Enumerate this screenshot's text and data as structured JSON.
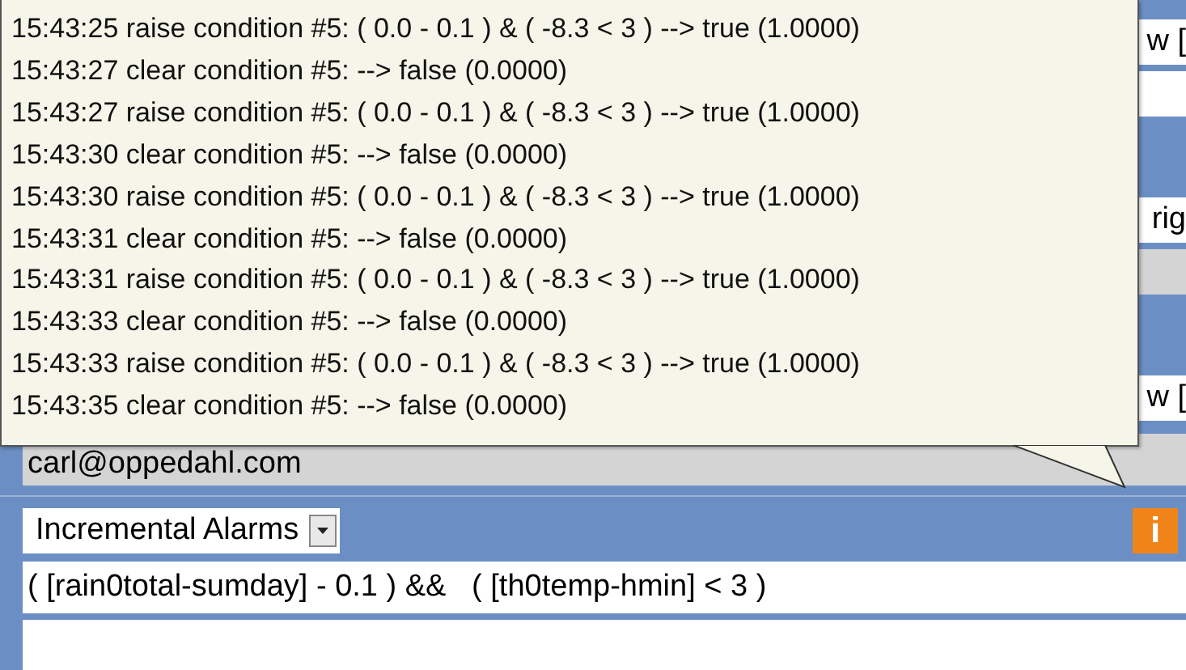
{
  "background_fields": [
    {
      "kind": "text",
      "value": "w ["
    },
    {
      "kind": "text"
    },
    {
      "kind": "band"
    },
    {
      "kind": "text",
      "value": "rig"
    },
    {
      "kind": "grey"
    },
    {
      "kind": "band"
    },
    {
      "kind": "text",
      "value": "w ["
    }
  ],
  "email": "carl@oppedahl.com",
  "alarm_type": {
    "value": "Incremental Alarms",
    "info": "i"
  },
  "condition": "( [rain0total-sumday] - 0.1 ) &&   ( [th0temp-hmin] < 3 )",
  "tooltip": {
    "lines": [
      "15:43:25 raise condition #5: ( 0.0 - 0.1 ) & ( -8.3 < 3 ) --> true (1.0000)",
      "15:43:27 clear condition #5: --> false (0.0000)",
      "15:43:27 raise condition #5: ( 0.0 - 0.1 ) & ( -8.3 < 3 ) --> true (1.0000)",
      "15:43:30 clear condition #5: --> false (0.0000)",
      "15:43:30 raise condition #5: ( 0.0 - 0.1 ) & ( -8.3 < 3 ) --> true (1.0000)",
      "15:43:31 clear condition #5: --> false (0.0000)",
      "15:43:31 raise condition #5: ( 0.0 - 0.1 ) & ( -8.3 < 3 ) --> true (1.0000)",
      "15:43:33 clear condition #5: --> false (0.0000)",
      "15:43:33 raise condition #5: ( 0.0 - 0.1 ) & ( -8.3 < 3 ) --> true (1.0000)",
      "15:43:35 clear condition #5: --> false (0.0000)"
    ]
  }
}
